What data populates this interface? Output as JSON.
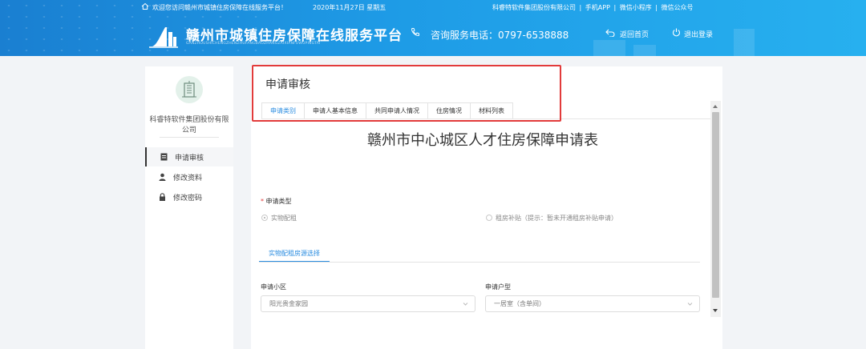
{
  "header": {
    "welcome_text": "欢迎您访问赣州市城镇住房保障在线服务平台！",
    "date_text": "2020年11月27日 星期五",
    "company_link": "科睿特软件集团股份有限公司",
    "links": [
      "手机APP",
      "微信小程序",
      "微信公众号"
    ],
    "separator": "|",
    "brand_title": "赣州市城镇住房保障在线服务平台",
    "brand_subtitle": "GANZHOUSHICHENGZHENZHUFANGBAOZHANGZAIXIANFUWUPINGTAI",
    "hotline": "咨询服务电话：0797-6538888",
    "back_home": "返回首页",
    "logout": "退出登录",
    "accent_color": "#1e9be6"
  },
  "sidebar": {
    "company_name": "科睿特软件集团股份有限公司",
    "items": [
      {
        "label": "申请审核",
        "icon": "form-icon"
      },
      {
        "label": "修改资料",
        "icon": "user-icon"
      },
      {
        "label": "修改密码",
        "icon": "lock-icon"
      }
    ]
  },
  "main": {
    "title": "申请审核",
    "tabs": [
      "申请类别",
      "申请人基本信息",
      "共同申请人情况",
      "住房情况",
      "材料列表"
    ],
    "active_tab": 0,
    "form_title": "赣州市中心城区人才住房保障申请表",
    "apply_type_label": "申请类型",
    "required_mark": "*",
    "radio_option_1": "实物配租",
    "radio_option_2": "租房补贴（提示：暂未开通租房补贴申请）",
    "subtab_label": "实物配租房源选择",
    "community_label": "申请小区",
    "community_value": "阳光贵金家园",
    "unit_type_label": "申请户型",
    "unit_type_value": "一居室（含单间）",
    "highlight_color": "#e23b3b"
  }
}
